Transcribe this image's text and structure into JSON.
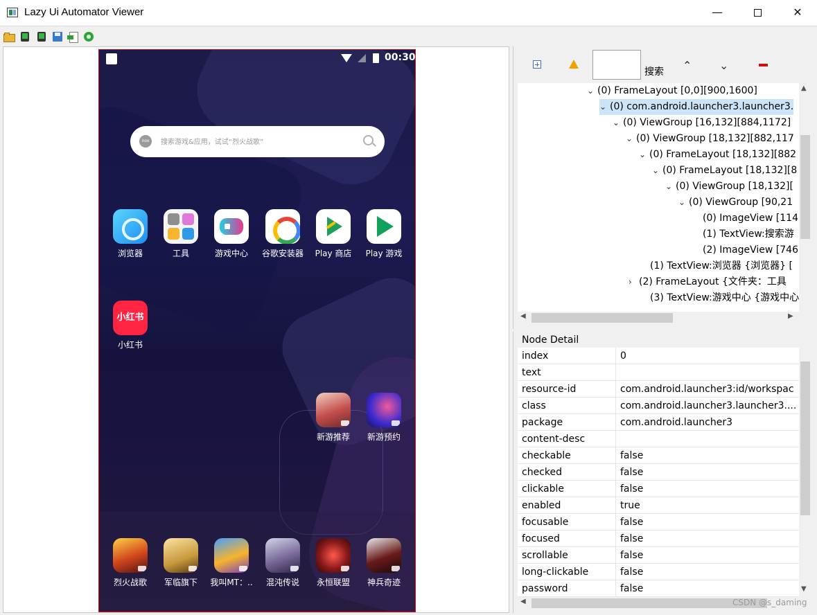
{
  "window": {
    "title": "Lazy Ui Automator Viewer",
    "min_glyph": "—",
    "close_glyph": "✕"
  },
  "toolbar": {
    "icons": [
      "open-folder-icon",
      "device-screenshot-icon",
      "device-screenshot-compressed-icon",
      "save-icon",
      "import-icon",
      "refresh-icon"
    ]
  },
  "phone": {
    "status_time": "00:30",
    "search_placeholder": "搜索游戏&应用，试试“烈火战歌”",
    "search_logo": "nox",
    "apps_row1": [
      {
        "label": "浏览器",
        "icon": "browser-icon"
      },
      {
        "label": "工具",
        "icon": "tools-folder-icon"
      },
      {
        "label": "游戏中心",
        "icon": "game-center-icon"
      },
      {
        "label": "谷歌安装器",
        "icon": "google-installer-icon"
      },
      {
        "label": "Play 商店",
        "icon": "play-store-icon"
      },
      {
        "label": "Play 游戏",
        "icon": "play-games-icon"
      }
    ],
    "apps_row2": [
      {
        "label": "小红书",
        "icon": "xiaohongshu-icon",
        "tile_text": "小红书"
      }
    ],
    "apps_row3": [
      {
        "label": "新游推荐",
        "icon": "new-games-recommend-icon"
      },
      {
        "label": "新游预约",
        "icon": "new-games-reserve-icon"
      }
    ],
    "dock": [
      {
        "label": "烈火战歌",
        "icon": "game-liehuo-icon"
      },
      {
        "label": "军临旗下",
        "icon": "game-junlin-icon"
      },
      {
        "label": "我叫MT：..",
        "icon": "game-mt-icon"
      },
      {
        "label": "混沌传说",
        "icon": "game-hundun-icon"
      },
      {
        "label": "永恒联盟",
        "icon": "game-yongheng-icon"
      },
      {
        "label": "神兵奇迹",
        "icon": "game-shenbing-icon"
      }
    ]
  },
  "tree_toolbar": {
    "search_label": "搜索",
    "search_value": "",
    "up_glyph": "⌃",
    "down_glyph": "⌄"
  },
  "tree": {
    "rows": [
      {
        "chevron": "⌄",
        "text": "(0) FrameLayout [0,0][900,1600]",
        "selected": false
      },
      {
        "chevron": "⌄",
        "text": "(0) com.android.launcher3.launcher3.",
        "selected": true
      },
      {
        "chevron": "⌄",
        "text": "(0) ViewGroup [16,132][884,1172]",
        "selected": false
      },
      {
        "chevron": "⌄",
        "text": "(0) ViewGroup [18,132][882,117",
        "selected": false
      },
      {
        "chevron": "⌄",
        "text": "(0) FrameLayout [18,132][882",
        "selected": false
      },
      {
        "chevron": "⌄",
        "text": "(0) FrameLayout [18,132][8",
        "selected": false
      },
      {
        "chevron": "⌄",
        "text": "(0) ViewGroup [18,132][",
        "selected": false
      },
      {
        "chevron": "⌄",
        "text": "(0) ViewGroup [90,21",
        "selected": false
      },
      {
        "chevron": "",
        "text": "(0) ImageView [114",
        "selected": false
      },
      {
        "chevron": "",
        "text": "(1) TextView:搜索游",
        "selected": false
      },
      {
        "chevron": "",
        "text": "(2) ImageView [746",
        "selected": false
      },
      {
        "chevron": "",
        "text": "(1) TextView:浏览器 {浏览器} [",
        "selected": false
      },
      {
        "chevron": "›",
        "text": "(2) FrameLayout {文件夹：工具",
        "selected": false
      },
      {
        "chevron": "",
        "text": "(3) TextView:游戏中心 {游戏中心",
        "selected": false
      }
    ]
  },
  "node_detail": {
    "title": "Node Detail",
    "rows": [
      {
        "key": "index",
        "value": "0"
      },
      {
        "key": "text",
        "value": ""
      },
      {
        "key": "resource-id",
        "value": "com.android.launcher3:id/workspac"
      },
      {
        "key": "class",
        "value": "com.android.launcher3.launcher3...."
      },
      {
        "key": "package",
        "value": "com.android.launcher3"
      },
      {
        "key": "content-desc",
        "value": ""
      },
      {
        "key": "checkable",
        "value": "false"
      },
      {
        "key": "checked",
        "value": "false"
      },
      {
        "key": "clickable",
        "value": "false"
      },
      {
        "key": "enabled",
        "value": "true"
      },
      {
        "key": "focusable",
        "value": "false"
      },
      {
        "key": "focused",
        "value": "false"
      },
      {
        "key": "scrollable",
        "value": "false"
      },
      {
        "key": "long-clickable",
        "value": "false"
      },
      {
        "key": "password",
        "value": "false"
      }
    ]
  },
  "watermark": "CSDN @s_daming",
  "colors": {
    "selection": "#cce4f7",
    "phone_border": "#d01010",
    "xhs_red": "#ff2442"
  }
}
